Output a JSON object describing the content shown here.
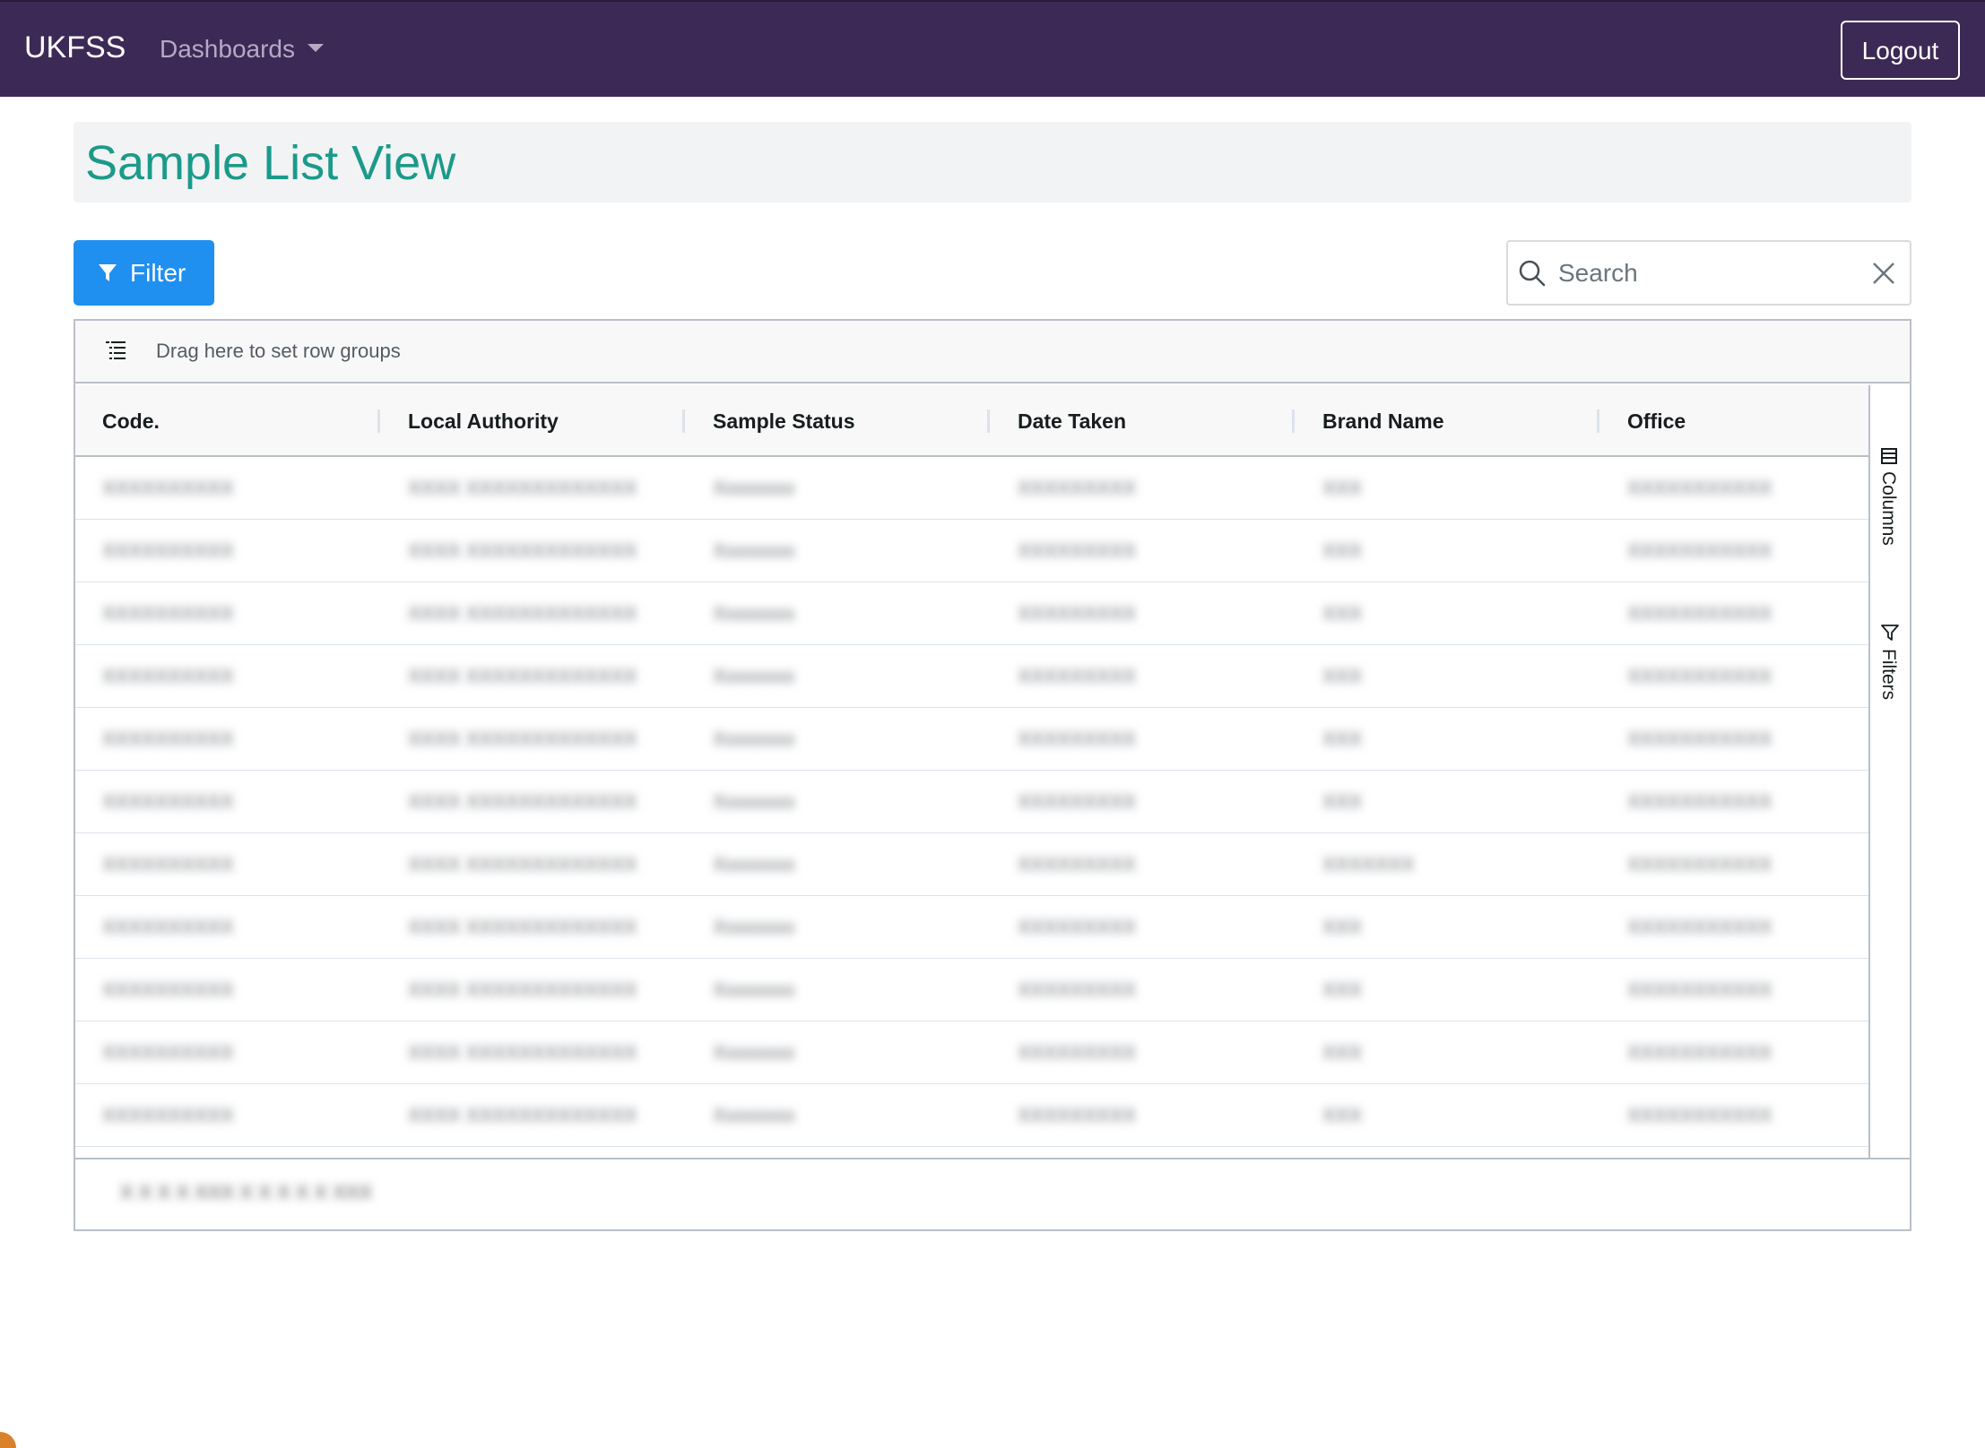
{
  "navbar": {
    "brand": "UKFSS",
    "dashboards_label": "Dashboards",
    "logout_label": "Logout"
  },
  "page": {
    "title": "Sample List View"
  },
  "toolbar": {
    "filter_label": "Filter",
    "search_placeholder": "Search",
    "search_value": ""
  },
  "grid": {
    "group_panel_text": "Drag here to set row groups",
    "columns": [
      "Code.",
      "Local Authority",
      "Sample Status",
      "Date Taken",
      "Brand Name",
      "Office"
    ],
    "side_buttons": [
      "Columns",
      "Filters"
    ],
    "rows": [
      [
        "XXXXXXXXXX",
        "XXXX XXXXXXXXXXXXX",
        "Xxxxxxxx",
        "XXXXXXXXX",
        "XXX",
        "XXXXXXXXXXX"
      ],
      [
        "XXXXXXXXXX",
        "XXXX XXXXXXXXXXXXX",
        "Xxxxxxxx",
        "XXXXXXXXX",
        "XXX",
        "XXXXXXXXXXX"
      ],
      [
        "XXXXXXXXXX",
        "XXXX XXXXXXXXXXXXX",
        "Xxxxxxxx",
        "XXXXXXXXX",
        "XXX",
        "XXXXXXXXXXX"
      ],
      [
        "XXXXXXXXXX",
        "XXXX XXXXXXXXXXXXX",
        "Xxxxxxxx",
        "XXXXXXXXX",
        "XXX",
        "XXXXXXXXXXX"
      ],
      [
        "XXXXXXXXXX",
        "XXXX XXXXXXXXXXXXX",
        "Xxxxxxxx",
        "XXXXXXXXX",
        "XXX",
        "XXXXXXXXXXX"
      ],
      [
        "XXXXXXXXXX",
        "XXXX XXXXXXXXXXXXX",
        "Xxxxxxxx",
        "XXXXXXXXX",
        "XXX",
        "XXXXXXXXXXX"
      ],
      [
        "XXXXXXXXXX",
        "XXXX XXXXXXXXXXXXX",
        "Xxxxxxxx",
        "XXXXXXXXX",
        "XXXXXXX",
        "XXXXXXXXXXX"
      ],
      [
        "XXXXXXXXXX",
        "XXXX XXXXXXXXXXXXX",
        "Xxxxxxxx",
        "XXXXXXXXX",
        "XXX",
        "XXXXXXXXXXX"
      ],
      [
        "XXXXXXXXXX",
        "XXXX XXXXXXXXXXXXX",
        "Xxxxxxxx",
        "XXXXXXXXX",
        "XXX",
        "XXXXXXXXXXX"
      ],
      [
        "XXXXXXXXXX",
        "XXXX XXXXXXXXXXXXX",
        "Xxxxxxxx",
        "XXXXXXXXX",
        "XXX",
        "XXXXXXXXXXX"
      ],
      [
        "XXXXXXXXXX",
        "XXXX XXXXXXXXXXXXX",
        "Xxxxxxxx",
        "XXXXXXXXX",
        "XXX",
        "XXXXXXXXXXX"
      ]
    ],
    "footer_text": "X X X X XXX  X X X X X XXX"
  },
  "colors": {
    "navbar_bg": "#3d2955",
    "title_color": "#1b9a8a",
    "filter_button_bg": "#1f8ff0"
  },
  "icons": {
    "filter": "funnel-icon",
    "search": "search-icon",
    "clear": "close-icon",
    "row_group": "row-group-icon",
    "columns": "columns-icon",
    "filters": "filter-outline-icon"
  }
}
